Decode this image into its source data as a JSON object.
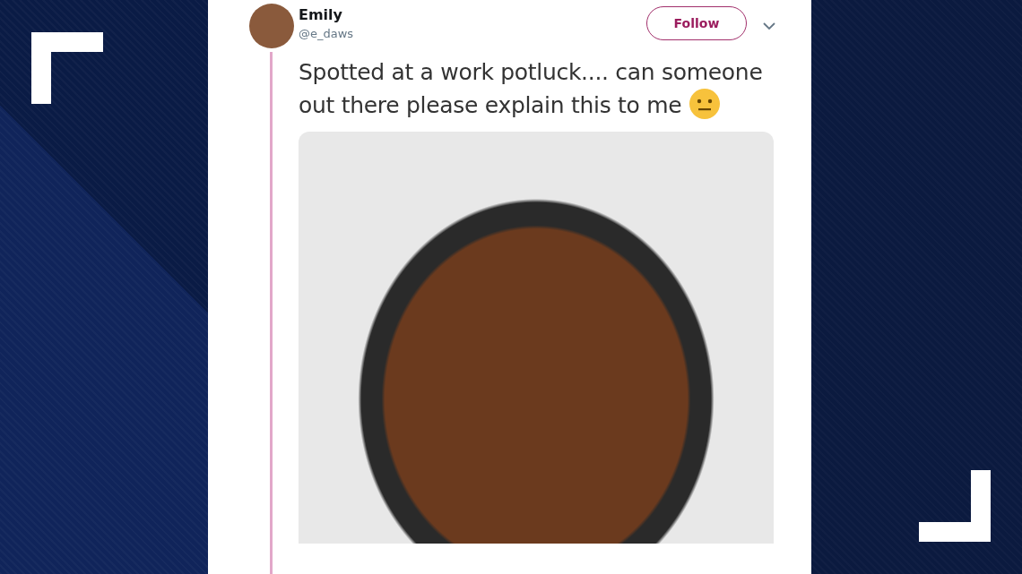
{
  "tweet": {
    "author_name": "Emily",
    "handle": "@e_daws",
    "follow_button": "Follow",
    "text": "Spotted at a work potluck.... can someone out there please explain this to me"
  }
}
